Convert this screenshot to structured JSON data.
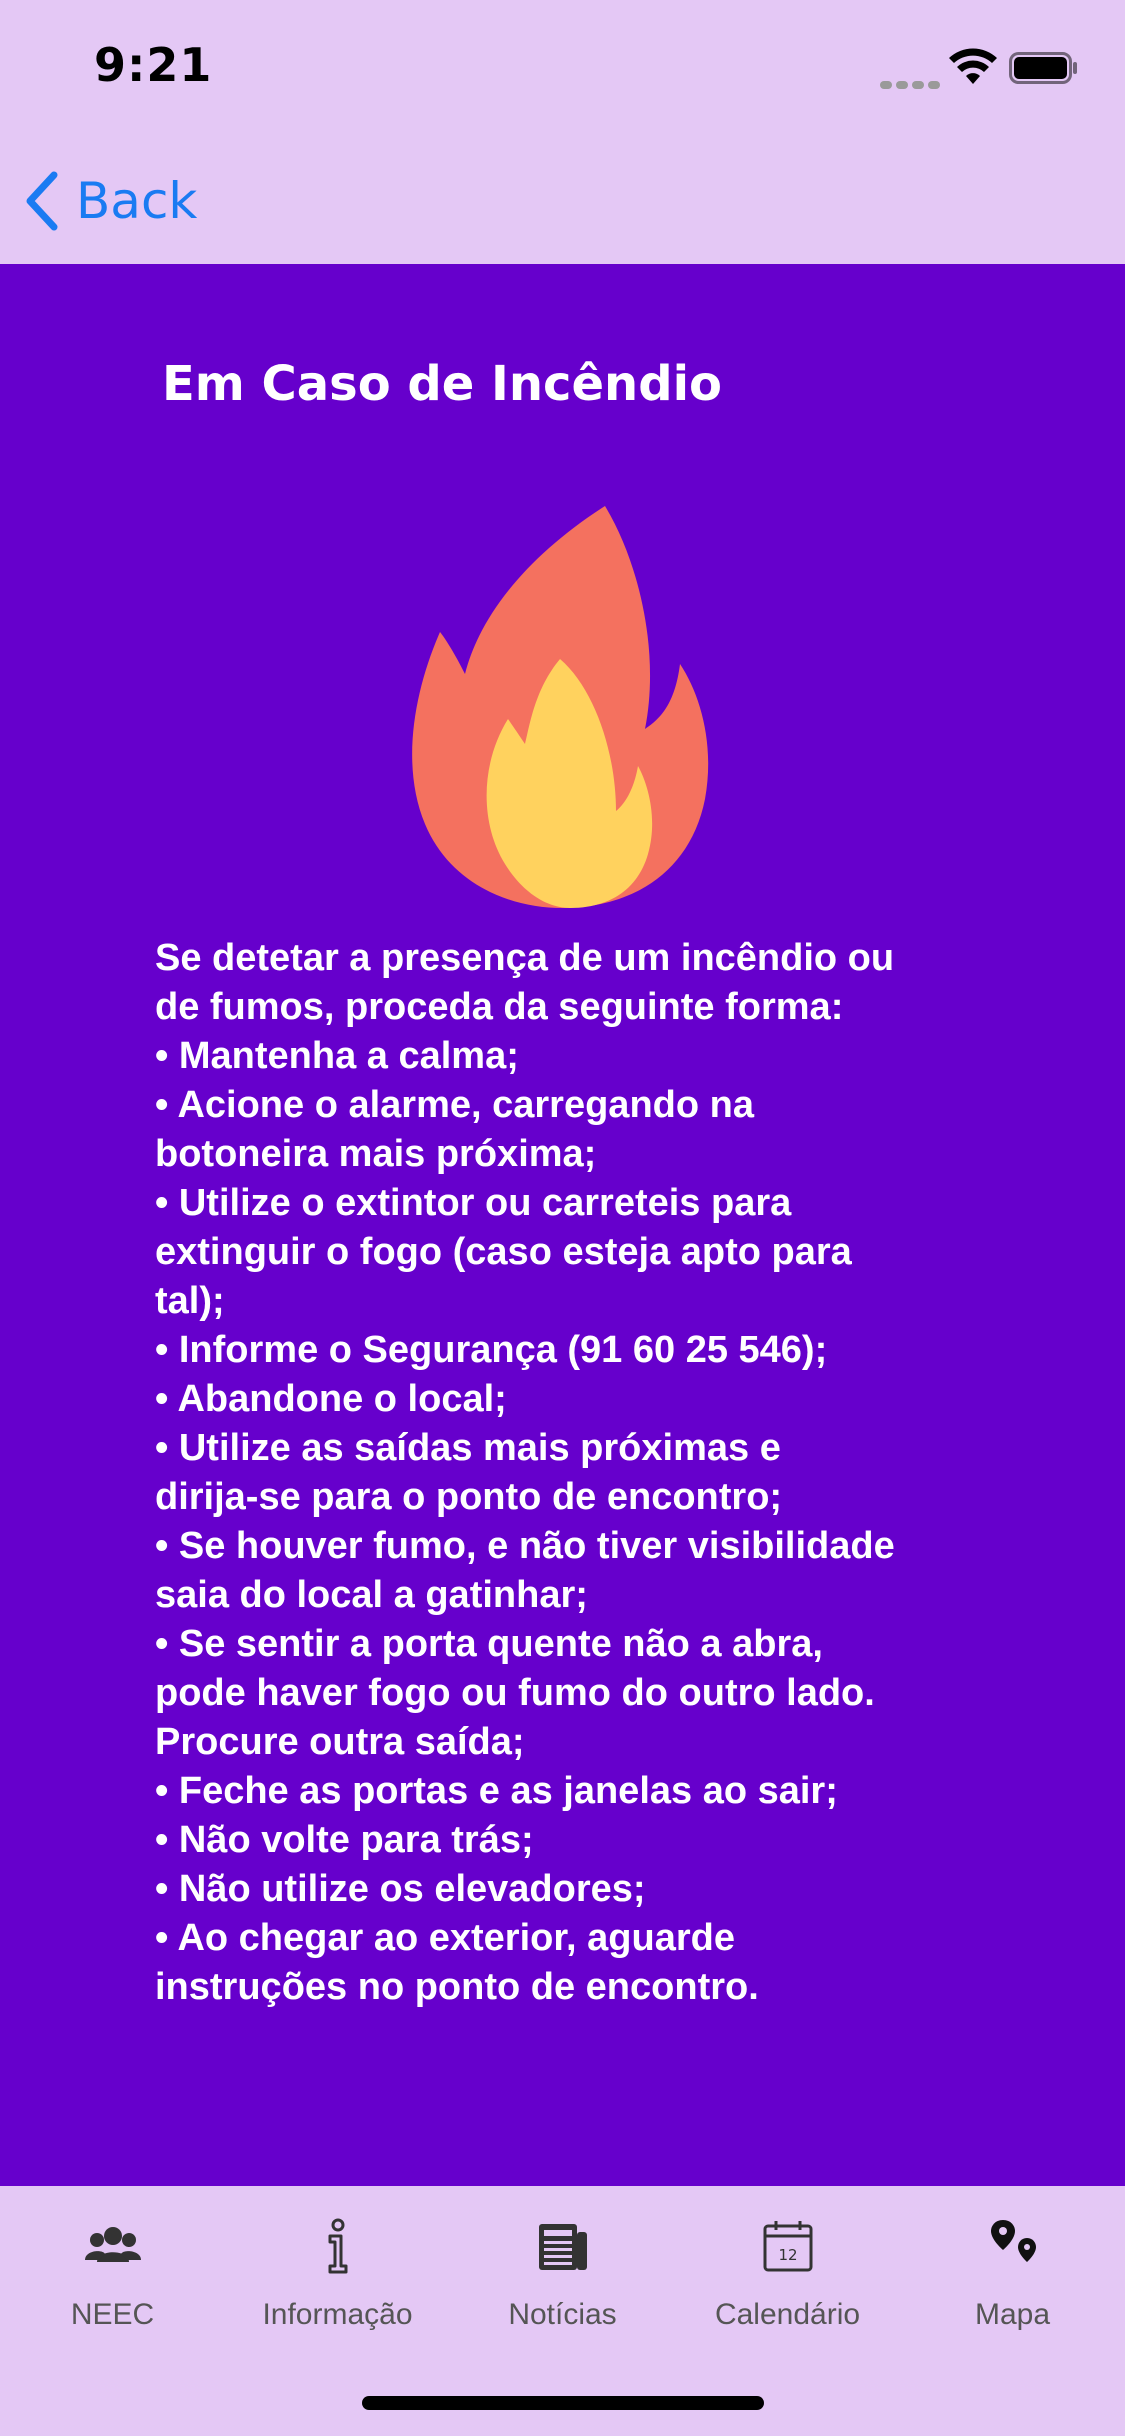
{
  "status_bar": {
    "time": "9:21"
  },
  "nav": {
    "back_label": "Back"
  },
  "page": {
    "title": "Em Caso de Incêndio",
    "lines": [
      " Se detetar a presença de um incêndio ou",
      "de fumos, proceda da seguinte forma:",
      " • Mantenha a calma;",
      " • Acione o alarme, carregando na",
      "botoneira mais próxima;",
      " • Utilize o extintor ou carreteis para",
      "extinguir o fogo (caso esteja apto para",
      "tal);",
      " • Informe o Segurança (91 60 25 546);",
      " • Abandone o local;",
      " • Utilize as saídas mais próximas e",
      "dirija-se para o ponto de encontro;",
      " • Se houver fumo, e não tiver visibilidade",
      "saia do local a gatinhar;",
      " • Se sentir a porta quente não a abra,",
      "pode haver fogo ou fumo do outro lado.",
      "Procure outra saída;",
      " • Feche as portas e as janelas ao sair;",
      " • Não volte para trás;",
      " • Não utilize os elevadores;",
      " • Ao chegar ao exterior, aguarde",
      "instruções no ponto de encontro."
    ]
  },
  "tabs": [
    {
      "label": "NEEC",
      "icon": "group-icon"
    },
    {
      "label": "Informação",
      "icon": "info-icon"
    },
    {
      "label": "Notícias",
      "icon": "newspaper-icon"
    },
    {
      "label": "Calendário",
      "icon": "calendar-icon",
      "calendar_day": "12"
    },
    {
      "label": "Mapa",
      "icon": "map-pins-icon"
    }
  ],
  "colors": {
    "background": "#e4c8f5",
    "content_background": "#6600cc",
    "accent": "#1a7bf2",
    "flame_outer": "#f4715f",
    "flame_inner": "#ffd25e"
  }
}
